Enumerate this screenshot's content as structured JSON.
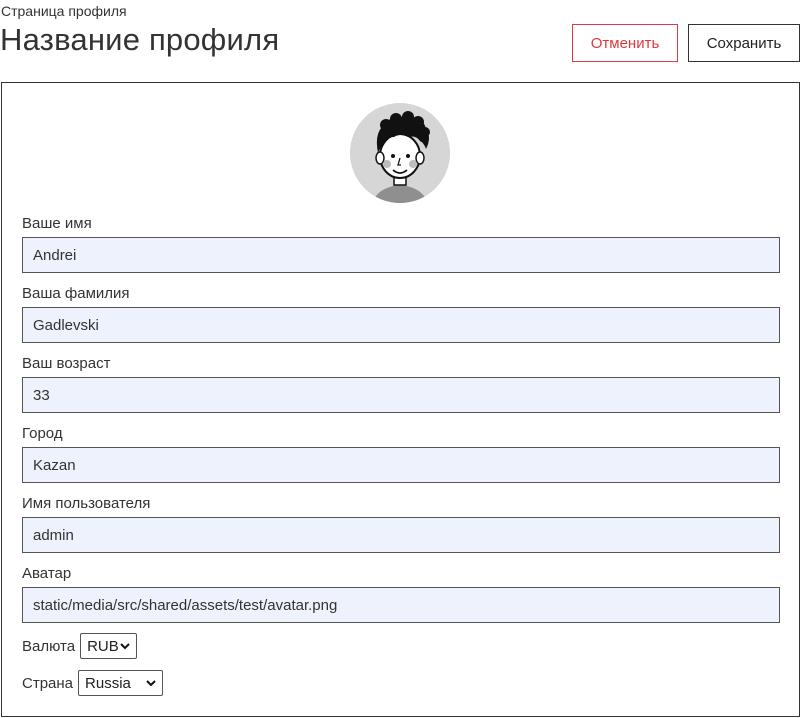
{
  "header": {
    "subtitle": "Страница профиля",
    "title": "Название профиля",
    "cancel_label": "Отменить",
    "save_label": "Сохранить"
  },
  "colors": {
    "cancel": "#e0383e",
    "input_bg": "#eef2fd"
  },
  "avatar": {
    "icon": "user-avatar-icon"
  },
  "fields": {
    "first_name": {
      "label": "Ваше имя",
      "value": "Andrei"
    },
    "last_name": {
      "label": "Ваша фамилия",
      "value": "Gadlevski"
    },
    "age": {
      "label": "Ваш возраст",
      "value": "33"
    },
    "city": {
      "label": "Город",
      "value": "Kazan"
    },
    "username": {
      "label": "Имя пользователя",
      "value": "admin"
    },
    "avatar_url": {
      "label": "Аватар",
      "value": "static/media/src/shared/assets/test/avatar.png"
    }
  },
  "selects": {
    "currency": {
      "label": "Валюта",
      "value": "RUB"
    },
    "country": {
      "label": "Страна",
      "value": "Russia"
    }
  }
}
